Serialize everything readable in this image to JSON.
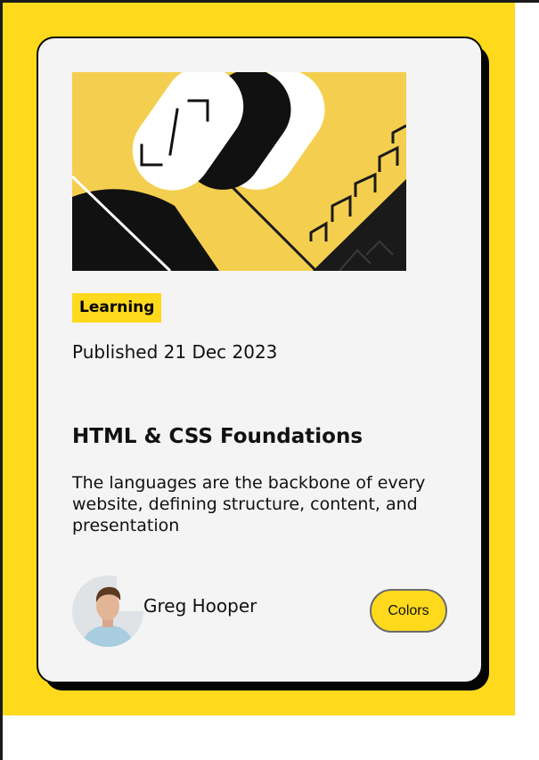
{
  "card": {
    "category": "Learning",
    "published": "Published 21 Dec 2023",
    "title": "HTML & CSS Foundations",
    "description": "The languages are the backbone of every website, defining structure, content, and presentation",
    "author": {
      "name": "Greg Hooper"
    },
    "button_label": "Colors"
  },
  "colors": {
    "accent": "#ffd91c",
    "card_background": "#f4f4f4",
    "hero_yellow": "#f4cf4f",
    "ink": "#111111"
  },
  "icons": [
    "hero-illustration",
    "avatar-photo"
  ]
}
